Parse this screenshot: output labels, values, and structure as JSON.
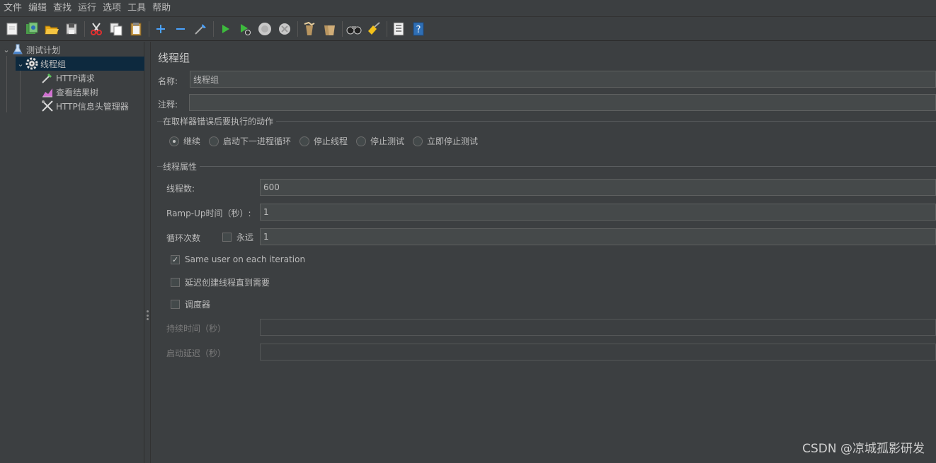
{
  "menu": [
    "文件",
    "编辑",
    "查找",
    "运行",
    "选项",
    "工具",
    "帮助"
  ],
  "toolbar": {
    "buttons": [
      "new-icon",
      "templates-icon",
      "open-icon",
      "save-icon",
      "cut-icon",
      "copy-icon",
      "paste-icon",
      "expand-icon",
      "collapse-icon",
      "toggle-icon",
      "start-icon",
      "start-no-timers-icon",
      "stop-icon",
      "shutdown-icon",
      "clear-icon",
      "clear-all-icon",
      "search-icon",
      "reset-search-icon",
      "function-helper-icon",
      "help-icon"
    ]
  },
  "tree": {
    "items": [
      {
        "label": "测试计划",
        "icon": "flask-icon"
      },
      {
        "label": "线程组",
        "icon": "gear-icon"
      },
      {
        "label": "HTTP请求",
        "icon": "pipette-icon"
      },
      {
        "label": "查看结果树",
        "icon": "chart-icon"
      },
      {
        "label": "HTTP信息头管理器",
        "icon": "tools-icon"
      }
    ]
  },
  "panel": {
    "title": "线程组",
    "name_label": "名称:",
    "name_value": "线程组",
    "comment_label": "注释:",
    "comment_value": "",
    "error_section": "在取样器错误后要执行的动作",
    "error_options": [
      "继续",
      "启动下一进程循环",
      "停止线程",
      "停止测试",
      "立即停止测试"
    ],
    "error_selected": 0,
    "thread_section": "线程属性",
    "threads_label": "线程数:",
    "threads_value": "600",
    "rampup_label": "Ramp-Up时间（秒）:",
    "rampup_value": "1",
    "loop_label": "循环次数",
    "forever_label": "永远",
    "loop_value": "1",
    "same_user_label": "Same user on each iteration",
    "delay_label": "延迟创建线程直到需要",
    "scheduler_label": "调度器",
    "duration_label": "持续时间（秒）",
    "duration_value": "",
    "startup_delay_label": "启动延迟（秒）",
    "startup_delay_value": ""
  },
  "watermark": "CSDN @凉城孤影研发"
}
